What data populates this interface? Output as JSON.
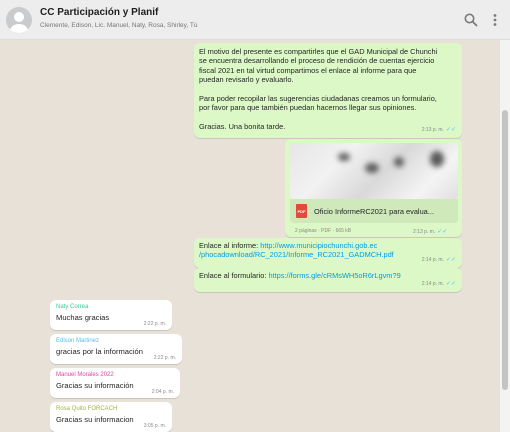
{
  "header": {
    "title": "CC Participación y Planif",
    "participants": "Clemente, Edison, Lic. Manuel, Naty, Rosa, Shirley, Tú"
  },
  "messages_out": [
    {
      "text": "El motivo del presente es compartirles que el GAD Municipal de Chunchi\nse encuentra desarrollando el proceso de rendición de cuentas ejercicio\nfiscal 2021 en tal virtud compartimos el enlace al informe para que\npuedan revisarlo y evaluarlo.\n\nPara poder recopilar las sugerencias ciudadanas creamos un formulario,\npor favor para que también puedan hacernos llegar sus opiniones.\n\nGracias. Una bonita tarde.",
      "time": "2:13 p. m."
    },
    {
      "doc_name": "Oficio InformeRC2021 para evalua...",
      "doc_icon": "PDF",
      "doc_info": "2 páginas · PDF · 665 kB",
      "time": "2:13 p. m."
    },
    {
      "label": "Enlace al informe:",
      "link": "http://www.municipiochunchi.gob.ec\n/phocadownload/RC_2021/Informe_RC2021_GADMCH.pdf",
      "time": "2:14 p. m."
    },
    {
      "label": "Enlace al formulario:",
      "link": "https://forms.gle/cRMsWH5oR6rLgvm?9",
      "time": "2:14 p. m."
    }
  ],
  "messages_in": [
    {
      "sender": "Naty Correa",
      "sender_color": "#35cd96",
      "text": "Muchas gracias",
      "time": "2:22 p. m."
    },
    {
      "sender": "Edison Martinez",
      "sender_color": "#53bdeb",
      "text": "gracias por la información",
      "time": "2:22 p. m."
    },
    {
      "sender": "Manuel Morales 2022",
      "sender_color": "#e542a3",
      "text": "Gracias  su  información",
      "time": "2:04 p. m."
    },
    {
      "sender": "Rosa Quito FORCACH",
      "sender_color": "#a5b337",
      "text": "Gracias su informacion",
      "time": "3:05 p. m."
    }
  ],
  "icons": {
    "search": "search-icon",
    "menu": "menu-icon",
    "tick": "double-check-icon",
    "doc": "pdf-icon"
  },
  "colors": {
    "outgoing": "#dcf8c6",
    "incoming": "#ffffff",
    "background": "#e8e1d8",
    "link": "#039be5"
  }
}
